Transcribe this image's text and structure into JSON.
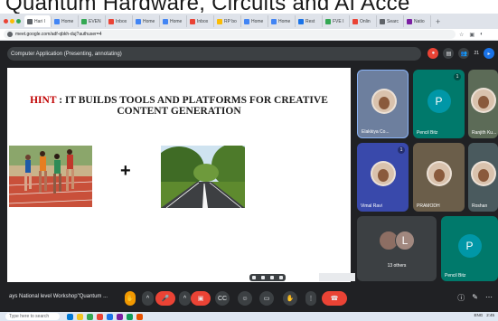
{
  "overlay": {
    "heading": "Quantum Hardware, Circuits and AI Acce"
  },
  "browser": {
    "tabs": [
      {
        "label": "Hari I",
        "color": "#5f6368"
      },
      {
        "label": "Home",
        "color": "#4285f4"
      },
      {
        "label": "EVEN",
        "color": "#34a853"
      },
      {
        "label": "Inbox",
        "color": "#ea4335"
      },
      {
        "label": "Home",
        "color": "#4285f4"
      },
      {
        "label": "Home",
        "color": "#4285f4"
      },
      {
        "label": "Inbox",
        "color": "#ea4335"
      },
      {
        "label": "RP bo",
        "color": "#fbbc04"
      },
      {
        "label": "Home",
        "color": "#4285f4"
      },
      {
        "label": "Home",
        "color": "#4285f4"
      },
      {
        "label": "Rest",
        "color": "#1a73e8"
      },
      {
        "label": "FVE I",
        "color": "#34a853"
      },
      {
        "label": "Onlin",
        "color": "#ea4335"
      },
      {
        "label": "Searc",
        "color": "#5f6368"
      },
      {
        "label": "Natio",
        "color": "#7b1fa2"
      }
    ],
    "url": "meet.google.com/adf-qbkh-duj?authuser=4"
  },
  "meet": {
    "presenting_label": "Computer Application (Presenting, annotating)",
    "participant_count": "21",
    "meeting_title": "ays National level Workshop\"Quantum ...",
    "raise_hand_badge": "1"
  },
  "slide": {
    "hint_word": "HINT",
    "title_rest": " : IT BUILDS TOOLS AND PLATFORMS FOR CREATIVE",
    "title_line2": "CONTENT GENERATION",
    "plus": "+"
  },
  "participants": [
    {
      "name": "Elakkiya Co...",
      "kind": "photo",
      "bg": "#6d7f9e"
    },
    {
      "name": "Pencil Bitz",
      "kind": "letter",
      "letter": "P",
      "bg": "#00796b",
      "circle": "#0097a7"
    },
    {
      "name": "Ranjith Ku...",
      "kind": "photo",
      "bg": "#5c6b57"
    },
    {
      "name": "Vimal Ravi",
      "kind": "photo",
      "bg": "#3949ab"
    },
    {
      "name": "PRAMODH",
      "kind": "photo",
      "bg": "#6b5e4a"
    },
    {
      "name": "Roshan",
      "kind": "photo",
      "bg": "#4a5a5e"
    },
    {
      "name": "13 others",
      "kind": "group",
      "letter": "L",
      "bg": "#3c4043"
    },
    {
      "name": "Pencil Bitz",
      "kind": "letter",
      "letter": "P",
      "bg": "#00796b",
      "circle": "#0097a7"
    }
  ],
  "taskbar": {
    "search_placeholder": "Type here to search",
    "time": "2:45",
    "lang": "ENG"
  }
}
